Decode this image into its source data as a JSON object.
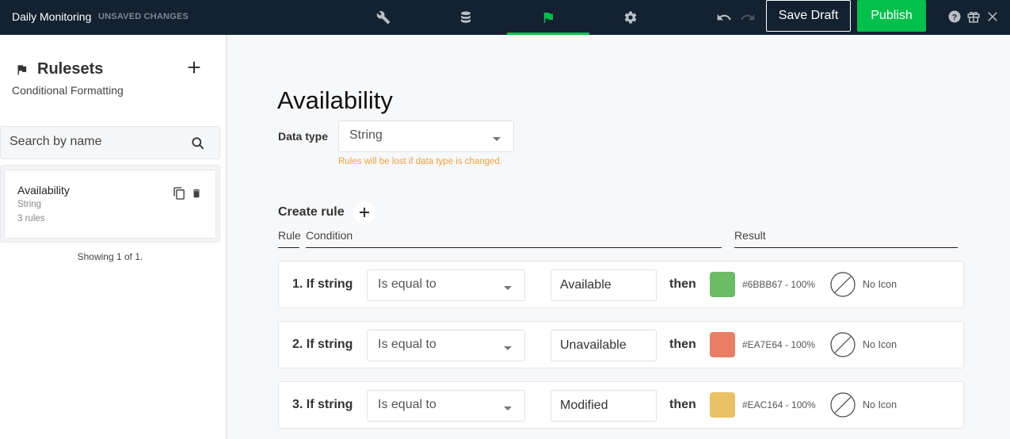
{
  "header": {
    "app_title": "Daily Monitoring",
    "status": "UNSAVED CHANGES",
    "tabs": [
      {
        "name": "wrench",
        "active": false
      },
      {
        "name": "database",
        "active": false
      },
      {
        "name": "flag",
        "active": true
      },
      {
        "name": "gear",
        "active": false
      }
    ],
    "save_draft_label": "Save Draft",
    "publish_label": "Publish",
    "accent_color": "#00C04B"
  },
  "sidebar": {
    "title": "Rulesets",
    "subtitle": "Conditional Formatting",
    "search_placeholder": "Search by name",
    "items": [
      {
        "name": "Availability",
        "type": "String",
        "rule_count": "3 rules"
      }
    ],
    "showing": "Showing 1 of 1."
  },
  "main": {
    "title": "Availability",
    "data_type_label": "Data type",
    "data_type_value": "String",
    "warning": "Rules will be lost if data type is changed.",
    "create_rule_label": "Create rule",
    "columns": {
      "rule": "Rule",
      "condition": "Condition",
      "result": "Result"
    },
    "rules": [
      {
        "label": "1.  If string",
        "operator": "Is equal to",
        "value": "Available",
        "then": "then",
        "color": "#6BBB67",
        "color_text": "#6BBB67 - 100%",
        "icon_text": "No Icon"
      },
      {
        "label": "2.  If string",
        "operator": "Is equal to",
        "value": "Unavailable",
        "then": "then",
        "color": "#EA7E64",
        "color_text": "#EA7E64 - 100%",
        "icon_text": "No Icon"
      },
      {
        "label": "3.  If string",
        "operator": "Is equal to",
        "value": "Modified",
        "then": "then",
        "color": "#EAC164",
        "color_text": "#EAC164 - 100%",
        "icon_text": "No Icon"
      }
    ]
  }
}
